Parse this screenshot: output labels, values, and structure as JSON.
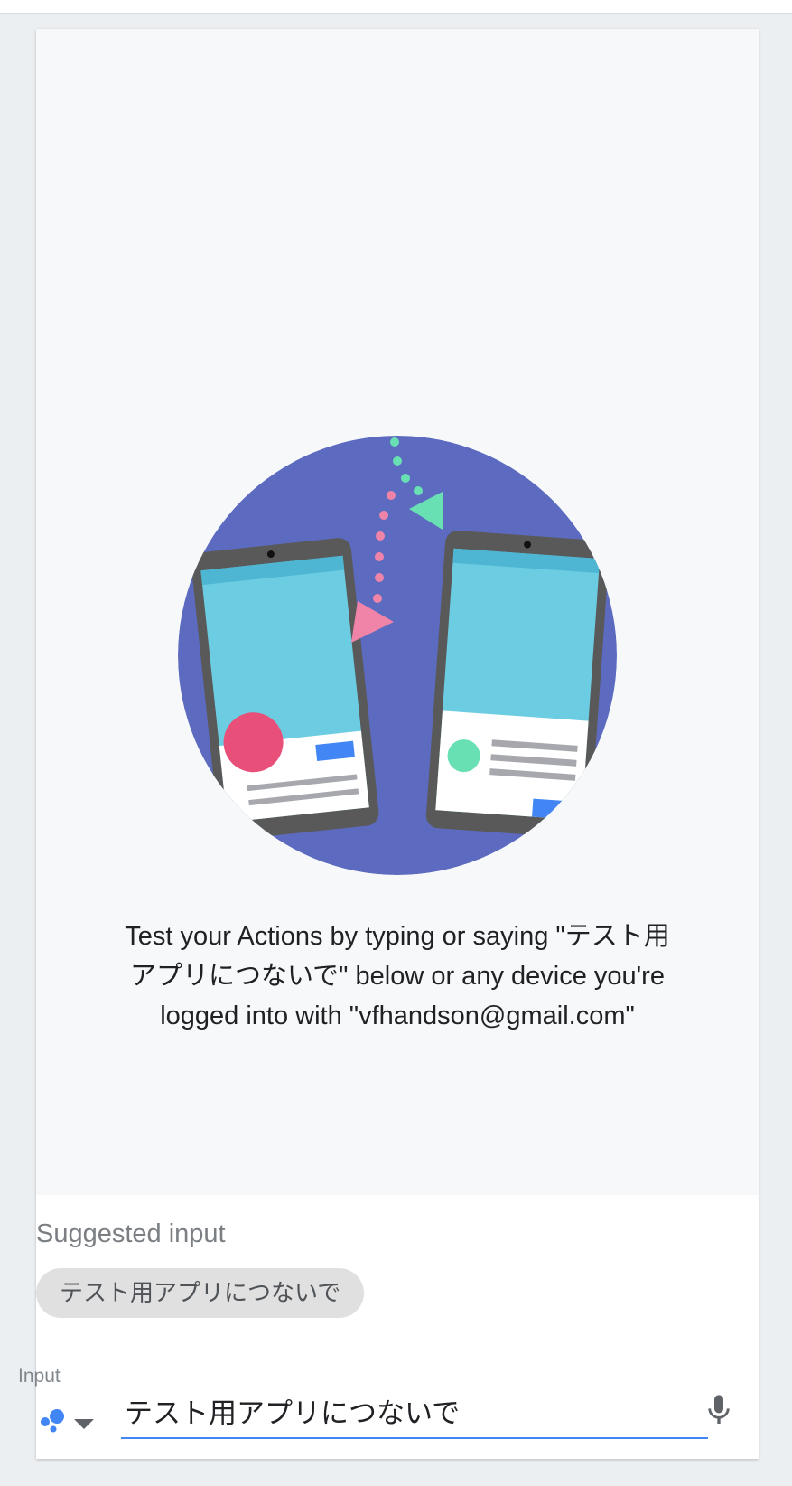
{
  "welcome_lines": [
    "Test your Actions by typing or saying \"テスト用",
    "アプリにつないで\" below or any device you're",
    "logged into with \"vfhandson@gmail.com\""
  ],
  "suggested": {
    "title": "Suggested input",
    "chips": [
      "テスト用アプリにつないで"
    ]
  },
  "input": {
    "label": "Input",
    "value": "テスト用アプリにつないで",
    "surface_icon": "assistant-dots-icon",
    "dropdown_icon": "caret-down-icon",
    "mic_icon": "microphone-icon"
  },
  "colors": {
    "accent": "#4285f4",
    "illustration_circle": "#5c6bc0",
    "chip_background": "#e0e0e0"
  }
}
